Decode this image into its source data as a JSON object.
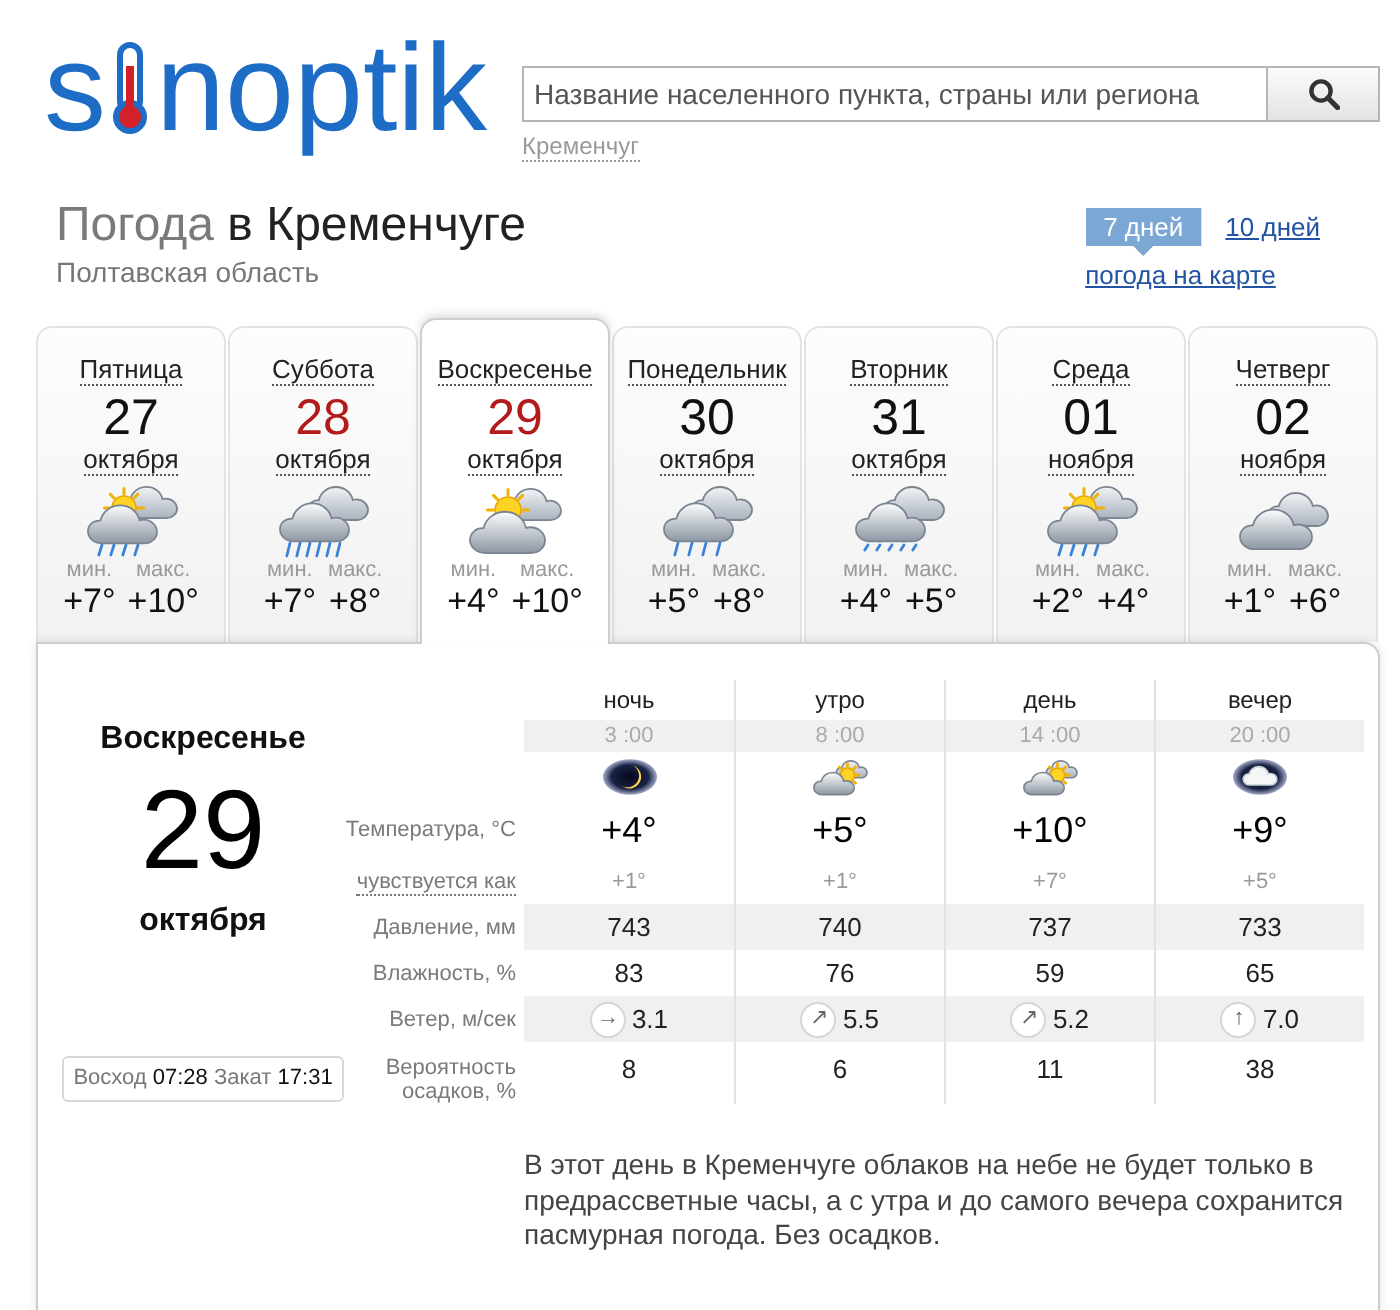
{
  "logo": {
    "parts": [
      "s",
      "noptik"
    ]
  },
  "search": {
    "placeholder": "Название населенного пункта, страны или региона",
    "recent": "Кременчуг"
  },
  "heading": {
    "muted": "Погода",
    "city": "в Кременчуге",
    "region": "Полтавская область"
  },
  "range_tabs": [
    {
      "label": "7 дней",
      "selected": true
    },
    {
      "label": "10 дней",
      "selected": false
    }
  ],
  "map_link": "погода на карте",
  "days": [
    {
      "weekday": "Пятница",
      "date": "27",
      "month": "октября",
      "weekend": false,
      "selected": false,
      "kind": "showers",
      "min_label": "мин.",
      "min": "+7°",
      "max_label": "макс.",
      "max": "+10°"
    },
    {
      "weekday": "Суббота",
      "date": "28",
      "month": "октября",
      "weekend": true,
      "selected": false,
      "kind": "downpour",
      "min_label": "мин.",
      "min": "+7°",
      "max_label": "макс.",
      "max": "+8°"
    },
    {
      "weekday": "Воскресенье",
      "date": "29",
      "month": "октября",
      "weekend": true,
      "selected": true,
      "kind": "partlycloudy",
      "min_label": "мин.",
      "min": "+4°",
      "max_label": "макс.",
      "max": "+10°"
    },
    {
      "weekday": "Понедельник",
      "date": "30",
      "month": "октября",
      "weekend": false,
      "selected": false,
      "kind": "rain",
      "min_label": "мин.",
      "min": "+5°",
      "max_label": "макс.",
      "max": "+8°"
    },
    {
      "weekday": "Вторник",
      "date": "31",
      "month": "октября",
      "weekend": false,
      "selected": false,
      "kind": "drizzle",
      "min_label": "мин.",
      "min": "+4°",
      "max_label": "макс.",
      "max": "+5°"
    },
    {
      "weekday": "Среда",
      "date": "01",
      "month": "ноября",
      "weekend": false,
      "selected": false,
      "kind": "showers",
      "min_label": "мин.",
      "min": "+2°",
      "max_label": "макс.",
      "max": "+4°"
    },
    {
      "weekday": "Четверг",
      "date": "02",
      "month": "ноября",
      "weekend": false,
      "selected": false,
      "kind": "cloudy",
      "min_label": "мин.",
      "min": "+1°",
      "max_label": "макс.",
      "max": "+6°"
    }
  ],
  "detail": {
    "weekday": "Воскресенье",
    "date": "29",
    "month": "октября",
    "sun": {
      "sunrise_label": "Восход",
      "sunrise": "07:28",
      "sunset_label": "Закат",
      "sunset": "17:31"
    },
    "periods": [
      {
        "name": "ночь",
        "time": "3 :00",
        "kind": "clearnight"
      },
      {
        "name": "утро",
        "time": "8 :00",
        "kind": "partlycloudy"
      },
      {
        "name": "день",
        "time": "14 :00",
        "kind": "partlycloudy"
      },
      {
        "name": "вечер",
        "time": "20 :00",
        "kind": "cloudynight"
      }
    ],
    "rows": [
      {
        "kind": "temperature",
        "label": "Температура, °C",
        "values": [
          "+4°",
          "+5°",
          "+10°",
          "+9°"
        ]
      },
      {
        "kind": "feels",
        "label": "чувствуется как",
        "values": [
          "+1°",
          "+1°",
          "+7°",
          "+5°"
        ]
      },
      {
        "kind": "pressure",
        "label": "Давление, мм",
        "values": [
          "743",
          "740",
          "737",
          "733"
        ]
      },
      {
        "kind": "humidity",
        "label": "Влажность, %",
        "values": [
          "83",
          "76",
          "59",
          "65"
        ]
      },
      {
        "kind": "wind",
        "label": "Ветер, м/сек",
        "values": [
          {
            "arrow": "→",
            "speed": "3.1"
          },
          {
            "arrow": "↗",
            "speed": "5.5"
          },
          {
            "arrow": "↗",
            "speed": "5.2"
          },
          {
            "arrow": "↑",
            "speed": "7.0"
          }
        ]
      },
      {
        "kind": "precipitation",
        "label": "Вероятность осадков, %",
        "values": [
          "8",
          "6",
          "11",
          "38"
        ]
      }
    ],
    "description": "В этот день в Кременчуге облаков на небе не будет только в предрассветные часы, а с утра и до самого вечера сохранится пасмурная погода. Без осадков."
  }
}
